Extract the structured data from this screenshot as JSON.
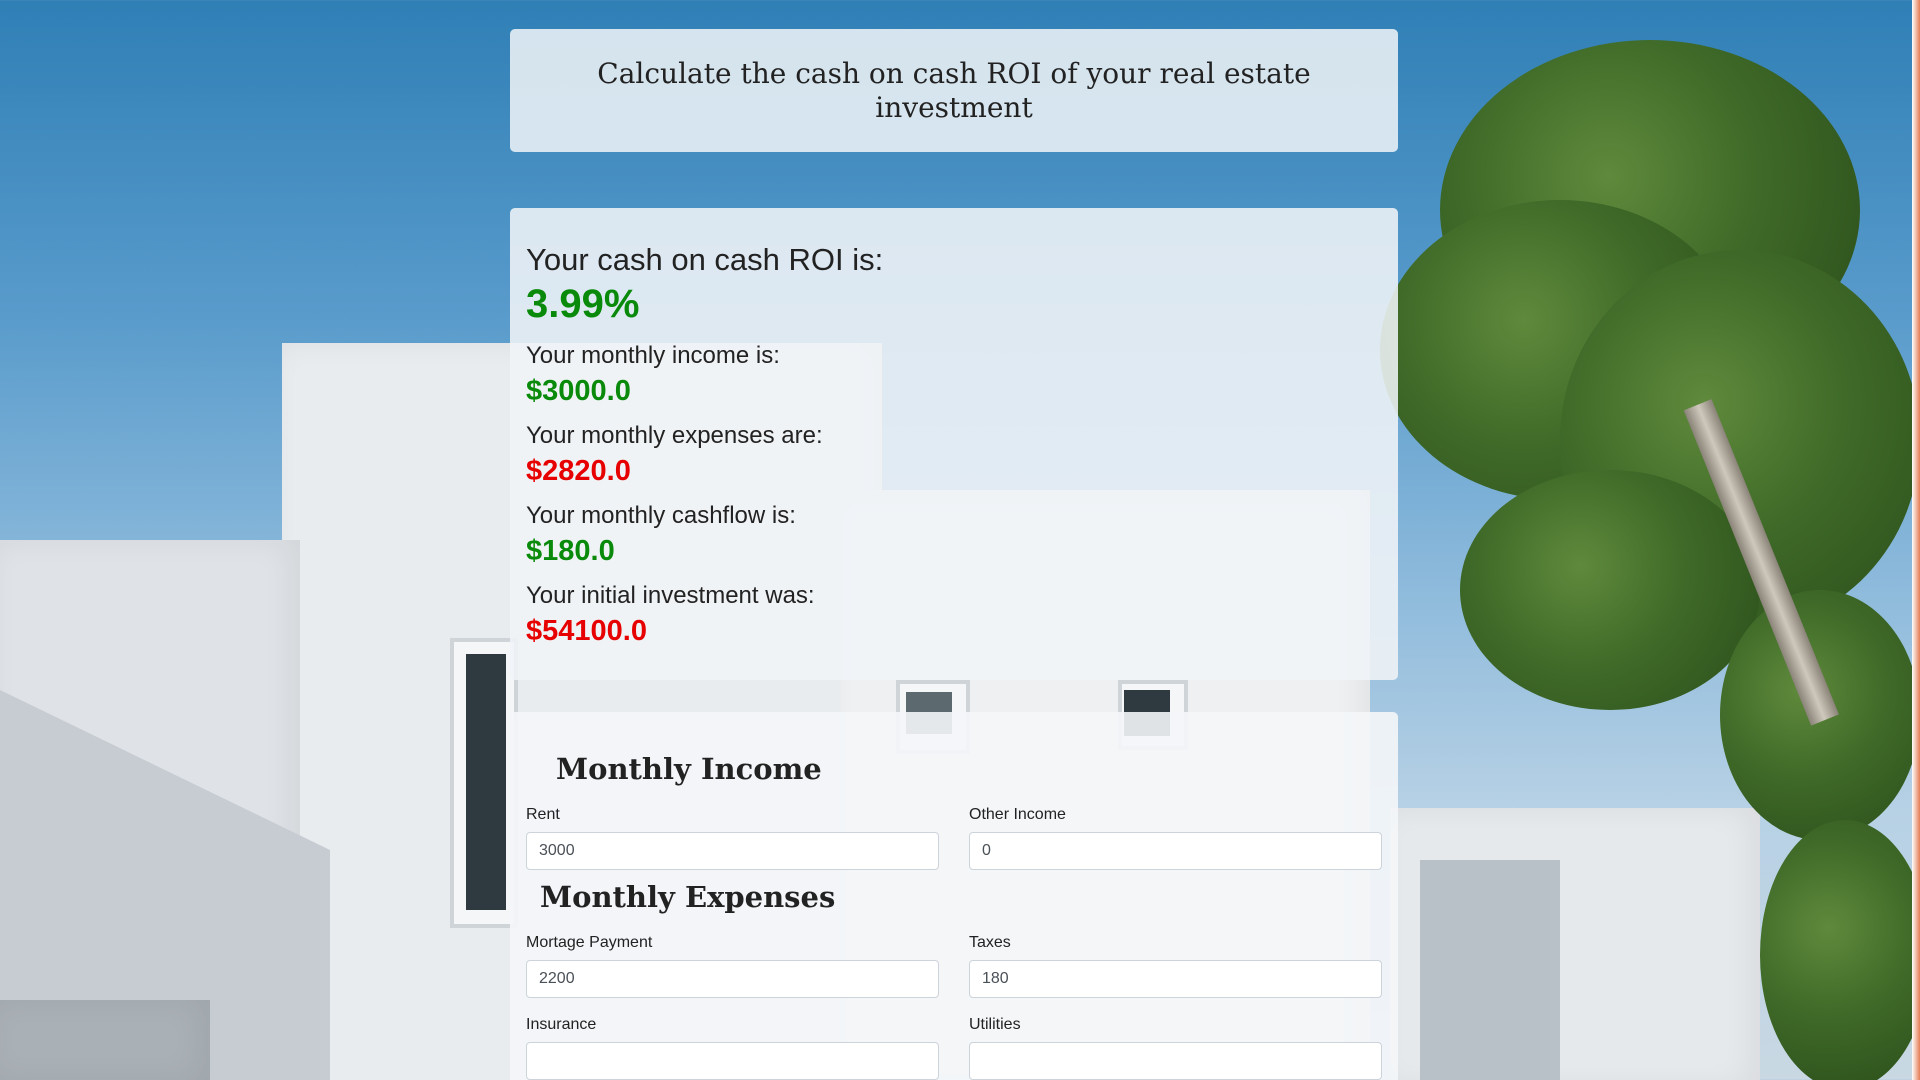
{
  "header": {
    "title": "Calculate the cash on cash ROI of your real estate investment"
  },
  "results": {
    "roi_label": "Your cash on cash ROI is:",
    "roi_value": "3.99%",
    "income_label": "Your monthly income is:",
    "income_value": "$3000.0",
    "expenses_label": "Your monthly expenses are:",
    "expenses_value": "$2820.0",
    "cashflow_label": "Your monthly cashflow is:",
    "cashflow_value": "$180.0",
    "investment_label": "Your initial investment was:",
    "investment_value": "$54100.0"
  },
  "form": {
    "income_section": "Monthly Income",
    "rent_label": "Rent",
    "rent_value": "3000",
    "other_income_label": "Other Income",
    "other_income_value": "0",
    "expenses_section": "Monthly Expenses",
    "mortgage_label": "Mortage Payment",
    "mortgage_value": "2200",
    "taxes_label": "Taxes",
    "taxes_value": "180",
    "insurance_label": "Insurance",
    "insurance_value": "",
    "utilities_label": "Utilities",
    "utilities_value": ""
  },
  "colors": {
    "positive": "#0a8a0a",
    "negative": "#e60000"
  }
}
